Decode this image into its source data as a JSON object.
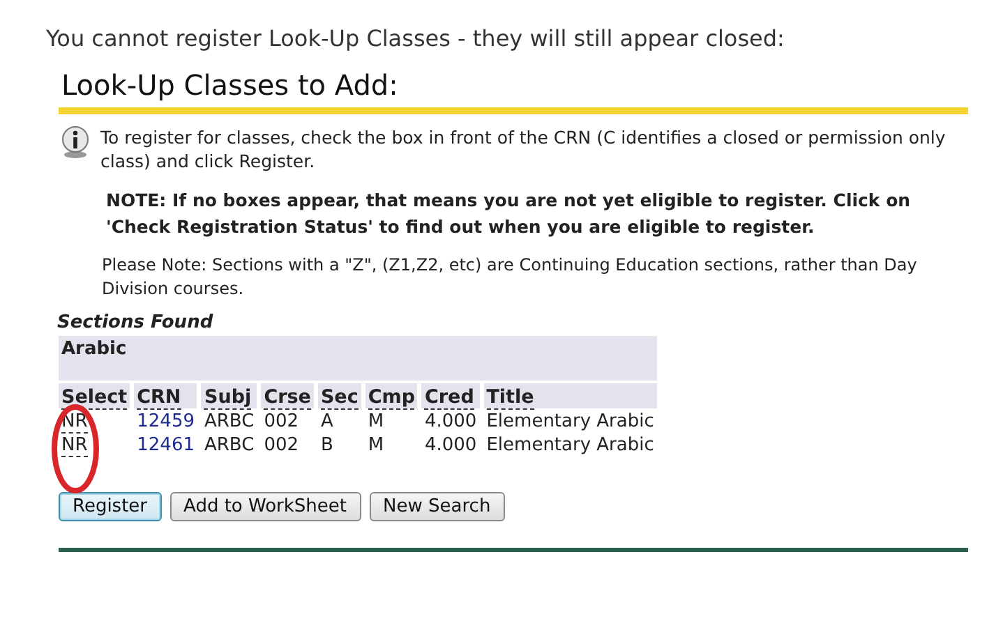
{
  "caption": "You cannot register Look-Up Classes - they will still appear closed:",
  "heading": "Look-Up Classes to Add:",
  "info": "To register for classes, check the box in front of the CRN (C identifies a closed or permission only class) and click Register.",
  "note": "NOTE: If no boxes appear, that means you are not yet eligible to register. Click on 'Check Registration Status' to find out when you are eligible to register.",
  "please_note": "Please Note: Sections with a \"Z\", (Z1,Z2, etc) are Continuing Education sections, rather than Day Division courses.",
  "sections_title": "Sections Found",
  "table": {
    "subject": "Arabic",
    "columns": [
      "Select",
      "CRN",
      "Subj",
      "Crse",
      "Sec",
      "Cmp",
      "Cred",
      "Title"
    ],
    "rows": [
      {
        "select": "NR",
        "crn": "12459",
        "subj": "ARBC",
        "crse": "002",
        "sec": "A",
        "cmp": "M",
        "cred": "4.000",
        "title": "Elementary Arabic"
      },
      {
        "select": "NR",
        "crn": "12461",
        "subj": "ARBC",
        "crse": "002",
        "sec": "B",
        "cmp": "M",
        "cred": "4.000",
        "title": "Elementary Arabic"
      }
    ]
  },
  "buttons": [
    {
      "label": "Register",
      "focused": true
    },
    {
      "label": "Add to WorkSheet",
      "focused": false
    },
    {
      "label": "New Search",
      "focused": false
    }
  ]
}
